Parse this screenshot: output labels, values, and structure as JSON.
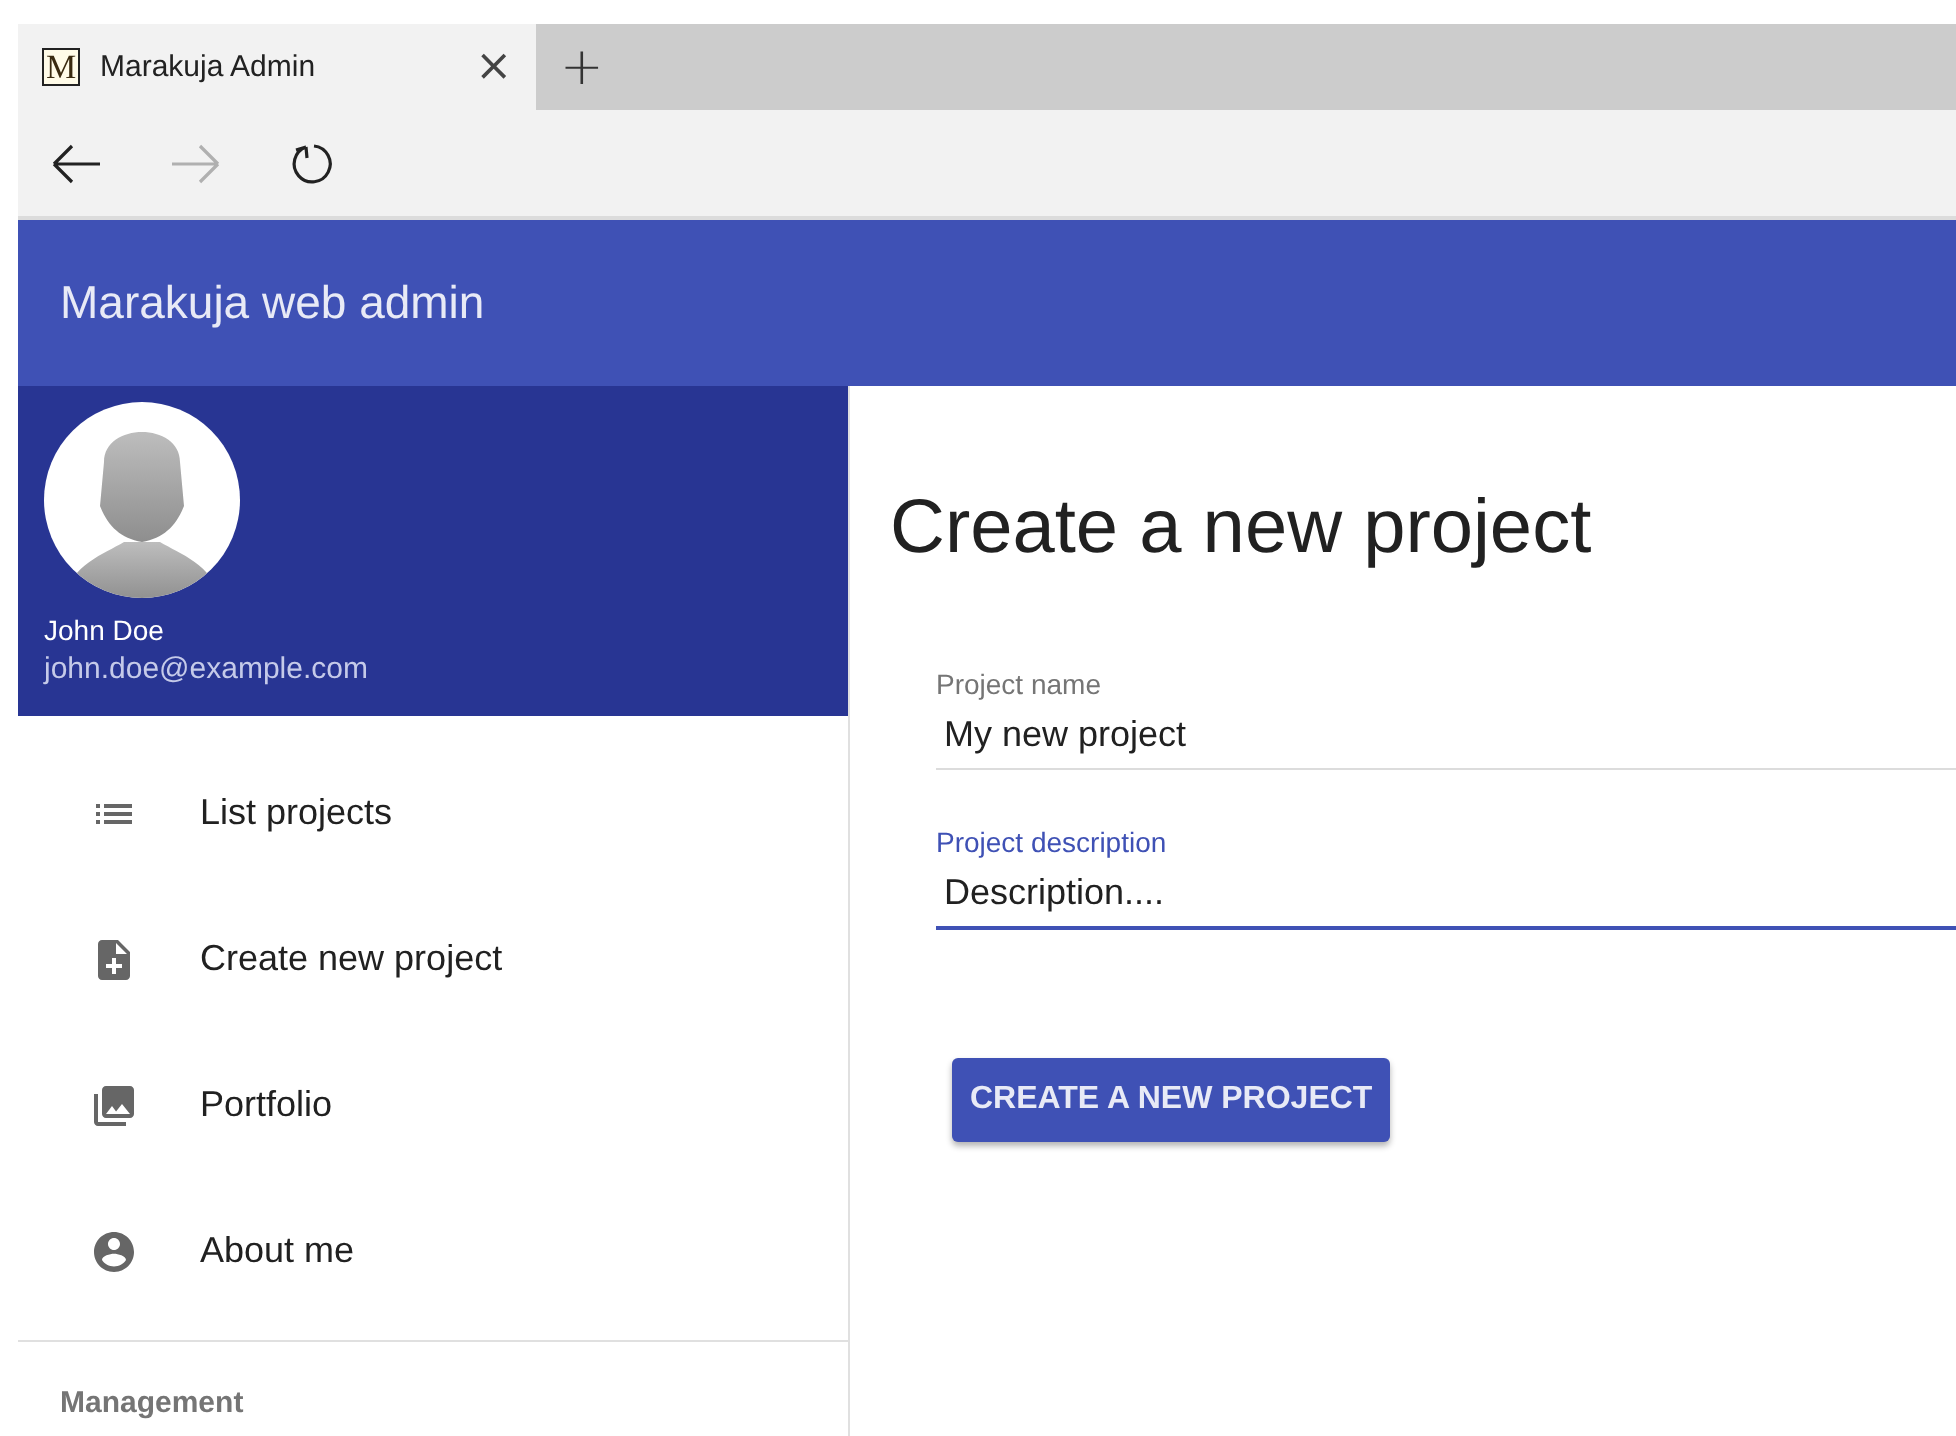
{
  "browser": {
    "tab": {
      "favicon": "M",
      "title": "Marakuja Admin",
      "close": "×",
      "selected": true
    },
    "new_tab": "+",
    "nav": [
      {
        "kind": "back",
        "disabled": false
      },
      {
        "kind": "forward",
        "disabled": true
      },
      {
        "kind": "reload",
        "disabled": false
      }
    ]
  },
  "app_bar": {
    "title": "Marakuja web admin"
  },
  "profile": {
    "name": "John Doe",
    "email": "john.doe@example.com"
  },
  "sidebar": {
    "items": [
      {
        "label": "List projects",
        "selected": false
      },
      {
        "label": "Create new project",
        "selected": false
      },
      {
        "label": "Portfolio",
        "selected": false
      },
      {
        "label": "About me",
        "selected": false
      }
    ],
    "section": "Management"
  },
  "main": {
    "heading": "Create a new project",
    "fields": [
      {
        "label": "Project name",
        "value": "My new project",
        "focused": false
      },
      {
        "label": "Project description",
        "value": "Description....",
        "focused": true
      }
    ],
    "button": "CREATE A NEW PROJECT"
  }
}
